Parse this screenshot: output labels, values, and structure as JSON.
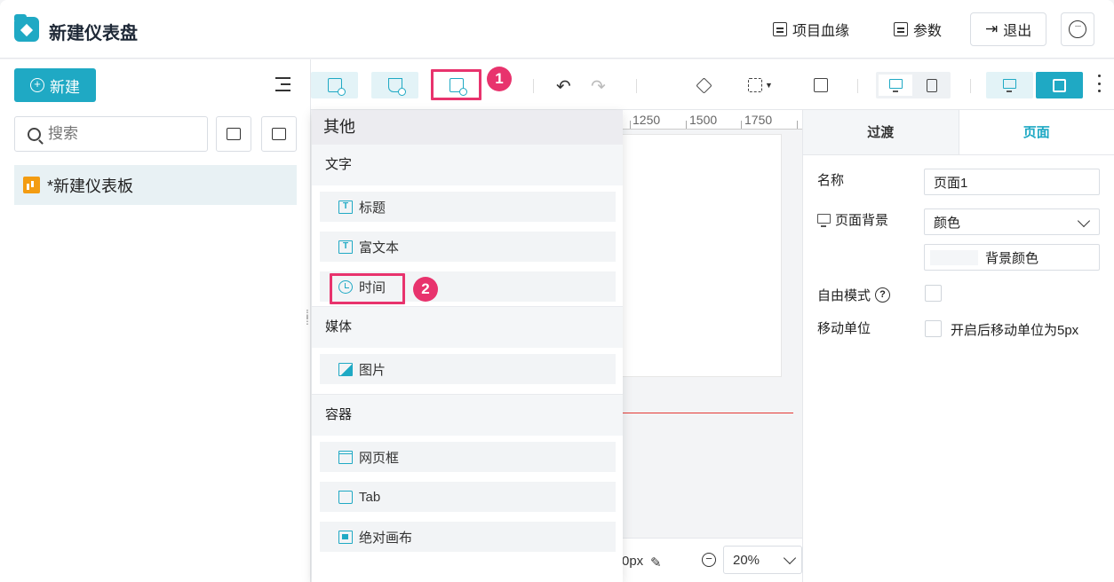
{
  "header": {
    "title": "新建仪表盘",
    "lineage_label": "项目血缘",
    "params_label": "参数",
    "exit_label": "退出",
    "more_icon": "more-icon"
  },
  "sidebar": {
    "new_label": "新建",
    "search_placeholder": "搜索",
    "tree_items": [
      {
        "label": "*新建仪表板",
        "icon": "dashboard-icon"
      }
    ]
  },
  "toolbar": {
    "step1": "1",
    "step2": "2"
  },
  "ruler": {
    "ticks": [
      "1250",
      "1500",
      "1750"
    ]
  },
  "bottom": {
    "offset_text": "0px",
    "zoom_value": "20%"
  },
  "dropdown": {
    "header": "其他",
    "sections": [
      {
        "label": "文字",
        "items": [
          "标题",
          "富文本",
          "时间"
        ]
      },
      {
        "label": "媒体",
        "items": [
          "图片"
        ]
      },
      {
        "label": "容器",
        "items": [
          "网页框",
          "Tab",
          "绝对画布"
        ]
      }
    ]
  },
  "props": {
    "tab_transition": "过渡",
    "tab_page": "页面",
    "name_label": "名称",
    "name_value": "页面1",
    "bg_label": "页面背景",
    "bg_value": "颜色",
    "bg_color_button": "背景颜色",
    "free_mode_label": "自由模式",
    "move_unit_label": "移动单位",
    "move_unit_checkbox_label": "开启后移动单位为5px"
  },
  "colors": {
    "accent": "#1fa9c4",
    "highlight": "#e8336d",
    "folder_icon": "#f39c12"
  }
}
